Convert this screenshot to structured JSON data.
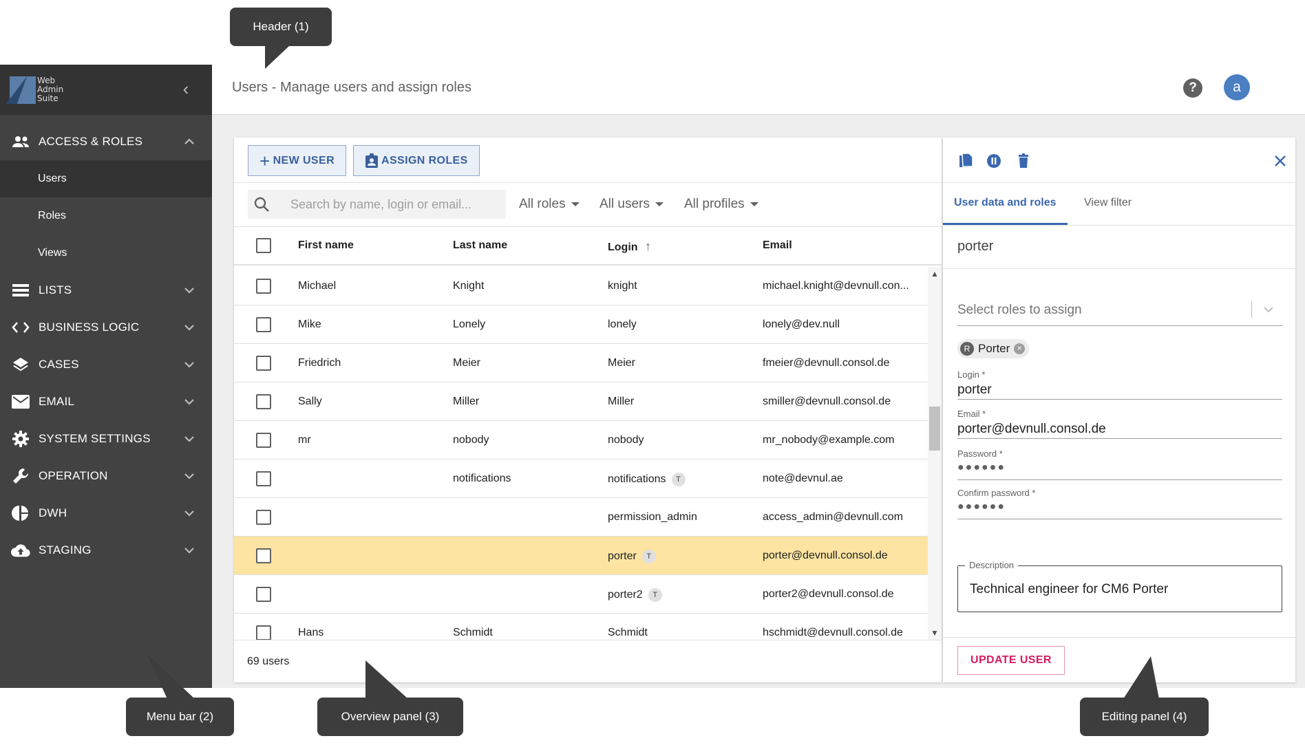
{
  "header": {
    "title": "Users - Manage users and assign roles",
    "help_label": "?",
    "avatar_initial": "a"
  },
  "sidebar": {
    "logo_lines": [
      "Web",
      "Admin",
      "Suite"
    ],
    "collapse_icon": "chevron-left-icon",
    "groups": [
      {
        "label": "ACCESS & ROLES",
        "icon": "people-icon",
        "expanded": true,
        "items": [
          {
            "label": "Users",
            "active": true
          },
          {
            "label": "Roles"
          },
          {
            "label": "Views"
          }
        ]
      },
      {
        "label": "LISTS",
        "icon": "list-icon"
      },
      {
        "label": "BUSINESS LOGIC",
        "icon": "code-icon"
      },
      {
        "label": "CASES",
        "icon": "layers-icon"
      },
      {
        "label": "EMAIL",
        "icon": "mail-icon"
      },
      {
        "label": "SYSTEM SETTINGS",
        "icon": "gear-icon"
      },
      {
        "label": "OPERATION",
        "icon": "wrench-icon"
      },
      {
        "label": "DWH",
        "icon": "pie-icon"
      },
      {
        "label": "STAGING",
        "icon": "cloud-upload-icon"
      }
    ]
  },
  "overview": {
    "new_user_label": "NEW USER",
    "assign_roles_label": "ASSIGN ROLES",
    "search_placeholder": "Search by name, login or email...",
    "filters": [
      "All roles",
      "All users",
      "All profiles"
    ],
    "columns": [
      "First name",
      "Last name",
      "Login",
      "Email"
    ],
    "sort_indicator": "↑",
    "rows": [
      {
        "first": "Michael",
        "last": "Knight",
        "login": "knight",
        "email": "michael.knight@devnull.con...",
        "technical": false
      },
      {
        "first": "Mike",
        "last": "Lonely",
        "login": "lonely",
        "email": "lonely@dev.null",
        "technical": false
      },
      {
        "first": "Friedrich",
        "last": "Meier",
        "login": "Meier",
        "email": "fmeier@devnull.consol.de",
        "technical": false
      },
      {
        "first": "Sally",
        "last": "Miller",
        "login": "Miller",
        "email": "smiller@devnull.consol.de",
        "technical": false
      },
      {
        "first": "mr",
        "last": "nobody",
        "login": "nobody",
        "email": "mr_nobody@example.com",
        "technical": false
      },
      {
        "first": "",
        "last": "notifications",
        "login": "notifications",
        "email": "note@devnul.ae",
        "technical": true
      },
      {
        "first": "",
        "last": "",
        "login": "permission_admin",
        "email": "access_admin@devnull.com",
        "technical": false
      },
      {
        "first": "",
        "last": "",
        "login": "porter",
        "email": "porter@devnull.consol.de",
        "technical": true,
        "selected": true
      },
      {
        "first": "",
        "last": "",
        "login": "porter2",
        "email": "porter2@devnull.consol.de",
        "technical": true
      },
      {
        "first": "Hans",
        "last": "Schmidt",
        "login": "Schmidt",
        "email": "hschmidt@devnull.consol.de",
        "technical": false
      }
    ],
    "technical_badge": "T",
    "footer_count": "69 users"
  },
  "editing": {
    "tabs": [
      "User data and roles",
      "View filter"
    ],
    "active_tab": 0,
    "name": "porter",
    "roles_placeholder": "Select roles to assign",
    "chip_initial": "R",
    "chip_label": "Porter",
    "chip_remove": "×",
    "login_label": "Login *",
    "login_value": "porter",
    "email_label": "Email *",
    "email_value": "porter@devnull.consol.de",
    "password_label": "Password *",
    "password_value": "●●●●●●",
    "confirm_label": "Confirm password *",
    "confirm_value": "●●●●●●",
    "description_label": "Description",
    "description_value": "Technical engineer for CM6 Porter",
    "update_label": "UPDATE USER"
  },
  "callouts": {
    "header": "Header (1)",
    "menu": "Menu bar (2)",
    "overview": "Overview panel (3)",
    "editing": "Editing panel (4)"
  },
  "colors": {
    "sidebar_bg": "#424242",
    "sidebar_dark": "#333333",
    "accent_blue": "#3a67b0",
    "selected_row": "#fde4a2",
    "update_pink": "#d81b60",
    "callout_bg": "#3d3d3d"
  }
}
